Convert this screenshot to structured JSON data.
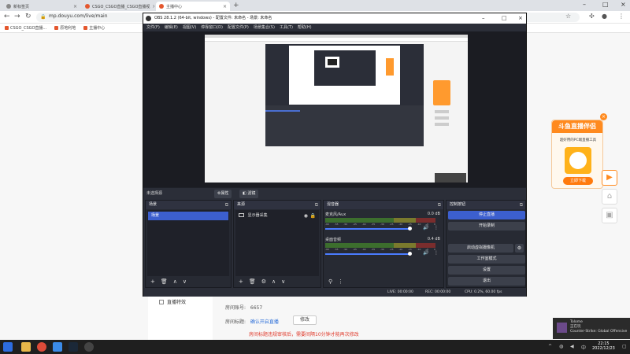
{
  "browser": {
    "tabs": [
      {
        "label": "新标签页",
        "active": false
      },
      {
        "label": "CSGO_CSGO直播_CSGO直播视",
        "active": false
      },
      {
        "label": "主播中心",
        "active": true
      }
    ],
    "new_tab": "+",
    "url": "mp.douyu.com/live/main",
    "bookmarks": [
      "CSGO_CSGO直播...",
      "原地利地",
      "主播中心"
    ]
  },
  "page": {
    "side_item": "直播特效",
    "room_number_label": "房间账号:",
    "room_number": "6657",
    "room_title_label": "房间标题:",
    "room_title_link": "确认开启直播",
    "edit_button": "修改",
    "warning": "房间标题违规审核后，需要间隔10分钟才能再次修改"
  },
  "ad": {
    "title": "斗鱼直播伴侣",
    "subtitle": "超好用的PC端直播工具",
    "download": "立即下载",
    "close": "×"
  },
  "toast": {
    "line1": "Tolome",
    "line2": "正在玩",
    "line3": "Counter-Strike: Global Offensive"
  },
  "taskbar": {
    "time": "22:15",
    "date": "2022/12/23"
  },
  "obs": {
    "title": "OBS 28.1.2 (64-bit, windows) - 配置文件: 未命名 - 场景: 未命名",
    "menu": [
      "文件(F)",
      "编辑(E)",
      "视图(V)",
      "停靠窗口(D)",
      "配置文件(P)",
      "场景集合(S)",
      "工具(T)",
      "帮助(H)"
    ],
    "no_scene": "未选择源",
    "properties": "⚙属性",
    "filters": "滤镜",
    "scenes": {
      "title": "场景",
      "items": [
        "场景"
      ]
    },
    "sources": {
      "title": "来源",
      "items": [
        "显示器采集"
      ]
    },
    "mixer": {
      "title": "混音器",
      "tracks": [
        {
          "name": "麦克风/Aux",
          "db": "0.0 dB",
          "level": 0.9
        },
        {
          "name": "桌面音频",
          "db": "0.4 dB",
          "level": 0.9
        }
      ],
      "ticks": [
        "-60",
        "-55",
        "-50",
        "-45",
        "-40",
        "-35",
        "-30",
        "-25",
        "-20",
        "-15",
        "-10",
        "-5",
        "0"
      ]
    },
    "controls": {
      "title": "控制按钮",
      "buttons": [
        "停止直播",
        "开始录制",
        "启动虚拟摄像机",
        "工作室模式",
        "设置",
        "退出"
      ]
    },
    "status": {
      "live": "LIVE: 00:00:00",
      "rec": "REC: 00:00:00",
      "cpu": "CPU: 0.2%, 60.00 fps"
    }
  }
}
